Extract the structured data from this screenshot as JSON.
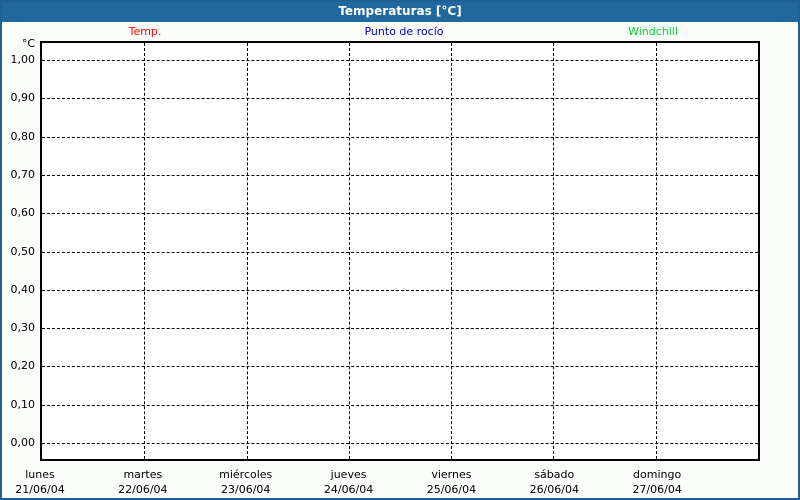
{
  "window": {
    "title": "Temperaturas [°C]"
  },
  "legend": {
    "items": [
      {
        "label": "Temp.",
        "color": "#ff0000"
      },
      {
        "label": "Punto de rocío",
        "color": "#0000cc"
      },
      {
        "label": "Windchill",
        "color": "#00cc33"
      }
    ]
  },
  "y_axis": {
    "unit": "°C",
    "ticks": [
      "1,00",
      "0,90",
      "0,80",
      "0,70",
      "0,60",
      "0,50",
      "0,40",
      "0,30",
      "0,20",
      "0,10",
      "0,00"
    ]
  },
  "x_axis": {
    "days": [
      {
        "name": "lunes",
        "date": "21/06/04"
      },
      {
        "name": "martes",
        "date": "22/06/04"
      },
      {
        "name": "miércoles",
        "date": "23/06/04"
      },
      {
        "name": "jueves",
        "date": "24/06/04"
      },
      {
        "name": "viernes",
        "date": "25/06/04"
      },
      {
        "name": "sábado",
        "date": "26/06/04"
      },
      {
        "name": "domingo",
        "date": "27/06/04"
      }
    ]
  },
  "chart_data": {
    "type": "line",
    "title": "Temperaturas [°C]",
    "ylabel": "°C",
    "ylim": [
      0.0,
      1.0
    ],
    "y_tick_step": 0.1,
    "x": [
      "21/06/04",
      "22/06/04",
      "23/06/04",
      "24/06/04",
      "25/06/04",
      "26/06/04",
      "27/06/04"
    ],
    "x_day_names": [
      "lunes",
      "martes",
      "miércoles",
      "jueves",
      "viernes",
      "sábado",
      "domingo"
    ],
    "series": [
      {
        "name": "Temp.",
        "color": "#ff0000",
        "values": []
      },
      {
        "name": "Punto de rocío",
        "color": "#0000cc",
        "values": []
      },
      {
        "name": "Windchill",
        "color": "#00cc33",
        "values": []
      }
    ],
    "grid": "dashed",
    "legend_position": "top"
  }
}
